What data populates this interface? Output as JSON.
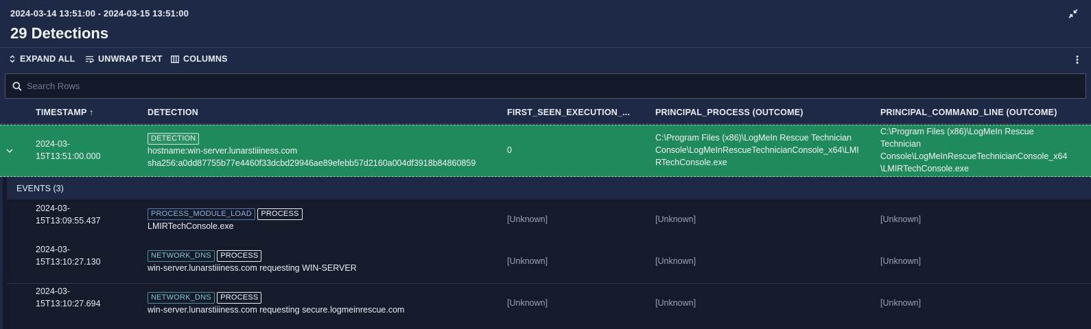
{
  "header": {
    "time_range": "2024-03-14 13:51:00 - 2024-03-15 13:51:00",
    "title": "29 Detections"
  },
  "toolbar": {
    "expand_all": "EXPAND ALL",
    "unwrap_text": "UNWRAP TEXT",
    "columns": "COLUMNS"
  },
  "search": {
    "placeholder": "Search Rows"
  },
  "columns": {
    "timestamp": "TIMESTAMP",
    "sort_indicator": "↑",
    "detection": "DETECTION",
    "first_seen": "FIRST_SEEN_EXECUTION_...",
    "principal_process": "PRINCIPAL_PROCESS (OUTCOME)",
    "principal_command_line": "PRINCIPAL_COMMAND_LINE (OUTCOME)"
  },
  "detection_row": {
    "timestamp_line1": "2024-03-",
    "timestamp_line2": "15T13:51:00.000",
    "tag": "DETECTION",
    "hostname": "hostname:win-server.lunarstiiiness.com",
    "sha256": "sha256:a0dd87755b77e4460f33dcbd29946ae89efebb57d2160a004df3918b84860859",
    "first_seen": "0",
    "process_lines": [
      "C:\\Program Files (x86)\\LogMeIn Rescue Technician",
      "Console\\LogMeInRescueTechnicianConsole_x64\\LMI",
      "RTechConsole.exe"
    ],
    "command_lines": [
      "C:\\Program Files (x86)\\LogMeIn Rescue",
      "Technician",
      "Console\\LogMeInRescueTechnicianConsole_x64",
      "\\LMIRTechConsole.exe"
    ]
  },
  "events": {
    "label": "EVENTS (3)",
    "rows": [
      {
        "timestamp_line1": "2024-03-",
        "timestamp_line2": "15T13:09:55.437",
        "tag1": "PROCESS_MODULE_LOAD",
        "tag2": "PROCESS",
        "description": "LMIRTechConsole.exe",
        "first_seen": "[Unknown]",
        "process": "[Unknown]",
        "command_line": "[Unknown]"
      },
      {
        "timestamp_line1": "2024-03-",
        "timestamp_line2": "15T13:10:27.130",
        "tag1": "NETWORK_DNS",
        "tag2": "PROCESS",
        "description": "win-server.lunarstiiiness.com requesting WIN-SERVER",
        "first_seen": "[Unknown]",
        "process": "[Unknown]",
        "command_line": "[Unknown]"
      },
      {
        "timestamp_line1": "2024-03-",
        "timestamp_line2": "15T13:10:27.694",
        "tag1": "NETWORK_DNS",
        "tag2": "PROCESS",
        "description": "win-server.lunarstiiiness.com requesting secure.logmeinrescue.com",
        "first_seen": "[Unknown]",
        "process": "[Unknown]",
        "command_line": "[Unknown]"
      }
    ]
  },
  "colors": {
    "background": "#1e2a45",
    "selected_row": "#1f8a5b",
    "event_row": "#161b2b"
  },
  "icons": {
    "collapse": "collapse-arrows-icon",
    "expand_all": "unfold-icon",
    "unwrap_text": "wrap-text-icon",
    "columns": "columns-icon",
    "more": "kebab-menu-icon",
    "search": "search-icon",
    "row_toggle": "chevron-down-icon"
  }
}
